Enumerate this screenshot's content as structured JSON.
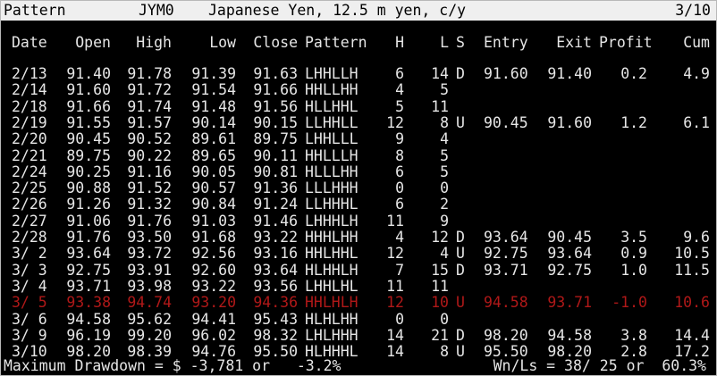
{
  "title_bar": {
    "app": "Pattern",
    "symbol": "JYM0",
    "description": "Japanese Yen, 12.5 m yen, c/y",
    "page": "3/10"
  },
  "columns": [
    "Date",
    "Open",
    "High",
    "Low",
    "Close",
    "Pattern",
    "H",
    "L",
    "S",
    "Entry",
    "Exit",
    "Profit",
    "Cum"
  ],
  "rows": [
    {
      "date": "2/13",
      "open": "91.40",
      "high": "91.78",
      "low": "91.39",
      "close": "91.63",
      "pattern": "LHHLLH",
      "h": "6",
      "l": "14",
      "s": "D",
      "entry": "91.60",
      "exit": "91.40",
      "profit": "0.2",
      "cum": "4.9",
      "highlight": false
    },
    {
      "date": "2/14",
      "open": "91.60",
      "high": "91.72",
      "low": "91.54",
      "close": "91.66",
      "pattern": "HHLLHH",
      "h": "4",
      "l": "5",
      "s": "",
      "entry": "",
      "exit": "",
      "profit": "",
      "cum": "",
      "highlight": false
    },
    {
      "date": "2/18",
      "open": "91.66",
      "high": "91.74",
      "low": "91.48",
      "close": "91.56",
      "pattern": "HLLHHL",
      "h": "5",
      "l": "11",
      "s": "",
      "entry": "",
      "exit": "",
      "profit": "",
      "cum": "",
      "highlight": false
    },
    {
      "date": "2/19",
      "open": "91.55",
      "high": "91.57",
      "low": "90.14",
      "close": "90.15",
      "pattern": "LLHHLL",
      "h": "12",
      "l": "8",
      "s": "U",
      "entry": "90.45",
      "exit": "91.60",
      "profit": "1.2",
      "cum": "6.1",
      "highlight": false
    },
    {
      "date": "2/20",
      "open": "90.45",
      "high": "90.52",
      "low": "89.61",
      "close": "89.75",
      "pattern": "LHHLLL",
      "h": "9",
      "l": "4",
      "s": "",
      "entry": "",
      "exit": "",
      "profit": "",
      "cum": "",
      "highlight": false
    },
    {
      "date": "2/21",
      "open": "89.75",
      "high": "90.22",
      "low": "89.65",
      "close": "90.11",
      "pattern": "HHLLLH",
      "h": "8",
      "l": "5",
      "s": "",
      "entry": "",
      "exit": "",
      "profit": "",
      "cum": "",
      "highlight": false
    },
    {
      "date": "2/24",
      "open": "90.25",
      "high": "91.16",
      "low": "90.05",
      "close": "90.81",
      "pattern": "HLLLHH",
      "h": "6",
      "l": "5",
      "s": "",
      "entry": "",
      "exit": "",
      "profit": "",
      "cum": "",
      "highlight": false
    },
    {
      "date": "2/25",
      "open": "90.88",
      "high": "91.52",
      "low": "90.57",
      "close": "91.36",
      "pattern": "LLLHHH",
      "h": "0",
      "l": "0",
      "s": "",
      "entry": "",
      "exit": "",
      "profit": "",
      "cum": "",
      "highlight": false
    },
    {
      "date": "2/26",
      "open": "91.26",
      "high": "91.32",
      "low": "90.84",
      "close": "91.24",
      "pattern": "LLHHHL",
      "h": "6",
      "l": "2",
      "s": "",
      "entry": "",
      "exit": "",
      "profit": "",
      "cum": "",
      "highlight": false
    },
    {
      "date": "2/27",
      "open": "91.06",
      "high": "91.76",
      "low": "91.03",
      "close": "91.46",
      "pattern": "LHHHLH",
      "h": "11",
      "l": "9",
      "s": "",
      "entry": "",
      "exit": "",
      "profit": "",
      "cum": "",
      "highlight": false
    },
    {
      "date": "2/28",
      "open": "91.76",
      "high": "93.50",
      "low": "91.68",
      "close": "93.22",
      "pattern": "HHHLHH",
      "h": "4",
      "l": "12",
      "s": "D",
      "entry": "93.64",
      "exit": "90.45",
      "profit": "3.5",
      "cum": "9.6",
      "highlight": false
    },
    {
      "date": "3/ 2",
      "open": "93.64",
      "high": "93.72",
      "low": "92.56",
      "close": "93.16",
      "pattern": "HHLHHL",
      "h": "12",
      "l": "4",
      "s": "U",
      "entry": "92.75",
      "exit": "93.64",
      "profit": "0.9",
      "cum": "10.5",
      "highlight": false
    },
    {
      "date": "3/ 3",
      "open": "92.75",
      "high": "93.91",
      "low": "92.60",
      "close": "93.64",
      "pattern": "HLHHLH",
      "h": "7",
      "l": "15",
      "s": "D",
      "entry": "93.71",
      "exit": "92.75",
      "profit": "1.0",
      "cum": "11.5",
      "highlight": false
    },
    {
      "date": "3/ 4",
      "open": "93.71",
      "high": "93.98",
      "low": "93.22",
      "close": "93.56",
      "pattern": "LHHLHL",
      "h": "11",
      "l": "11",
      "s": "",
      "entry": "",
      "exit": "",
      "profit": "",
      "cum": "",
      "highlight": false
    },
    {
      "date": "3/ 5",
      "open": "93.38",
      "high": "94.74",
      "low": "93.20",
      "close": "94.36",
      "pattern": "HHLHLH",
      "h": "12",
      "l": "10",
      "s": "U",
      "entry": "94.58",
      "exit": "93.71",
      "profit": "-1.0",
      "cum": "10.6",
      "highlight": true
    },
    {
      "date": "3/ 6",
      "open": "94.58",
      "high": "95.62",
      "low": "94.41",
      "close": "95.43",
      "pattern": "HLHLHH",
      "h": "0",
      "l": "0",
      "s": "",
      "entry": "",
      "exit": "",
      "profit": "",
      "cum": "",
      "highlight": false
    },
    {
      "date": "3/ 9",
      "open": "96.19",
      "high": "99.20",
      "low": "96.02",
      "close": "98.32",
      "pattern": "LHLHHH",
      "h": "14",
      "l": "21",
      "s": "D",
      "entry": "98.20",
      "exit": "94.58",
      "profit": "3.8",
      "cum": "14.4",
      "highlight": false
    },
    {
      "date": "3/10",
      "open": "98.20",
      "high": "98.39",
      "low": "94.76",
      "close": "95.50",
      "pattern": "HLHHHL",
      "h": "14",
      "l": "8",
      "s": "U",
      "entry": "95.50",
      "exit": "98.20",
      "profit": "2.8",
      "cum": "17.2",
      "highlight": false
    }
  ],
  "footer": {
    "left": "Maximum Drawdown = $ -3,781 or   -3.2%",
    "right": "Wn/Ls = 38/ 25 or  60.3%"
  },
  "colors": {
    "background": "#000000",
    "text": "#e6e6e6",
    "title_bar_bg": "#efefef",
    "highlight_row": "#b01818"
  }
}
